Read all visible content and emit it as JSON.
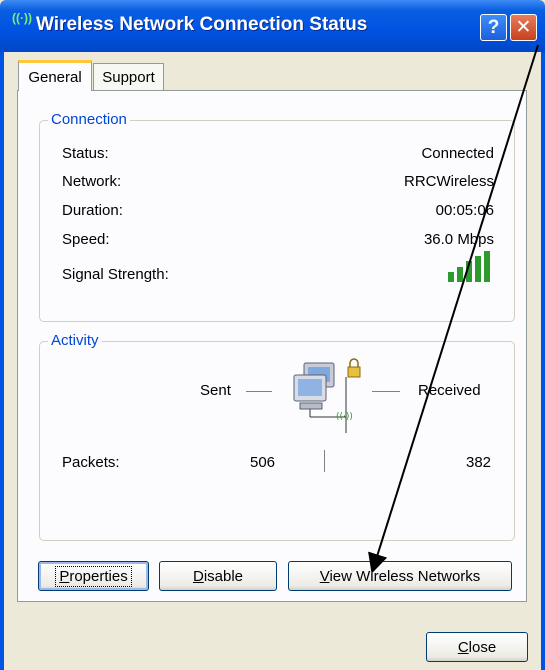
{
  "window": {
    "title": "Wireless Network Connection Status",
    "help_button": "?",
    "close_glyph": "✕"
  },
  "tabs": [
    {
      "label": "General",
      "active": true
    },
    {
      "label": "Support",
      "active": false
    }
  ],
  "connection": {
    "legend": "Connection",
    "status_label": "Status:",
    "status_value": "Connected",
    "network_label": "Network:",
    "network_value": "RRCWireless",
    "duration_label": "Duration:",
    "duration_value": "00:05:06",
    "speed_label": "Speed:",
    "speed_value": "36.0 Mbps",
    "signal_label": "Signal Strength:",
    "signal_bars": 5
  },
  "activity": {
    "legend": "Activity",
    "sent_label": "Sent",
    "received_label": "Received",
    "packets_label": "Packets:",
    "packets_sent": "506",
    "packets_received": "382"
  },
  "buttons": {
    "properties_underline": "P",
    "properties_rest": "roperties",
    "disable_underline": "D",
    "disable_rest": "isable",
    "view_underline": "V",
    "view_rest": "iew Wireless Networks",
    "close_underline": "C",
    "close_rest": "lose"
  },
  "colors": {
    "title_bar": "#0054e3",
    "legend_text": "#0046d5",
    "signal_bar": "#2e9a2e",
    "annotation_arrow": "#000000"
  }
}
